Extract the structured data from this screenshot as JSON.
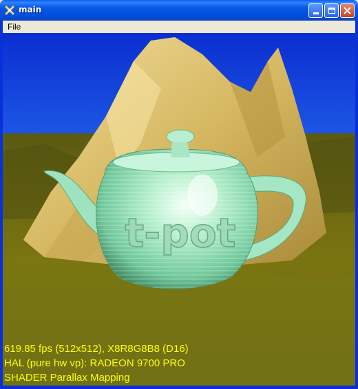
{
  "window": {
    "title": "main"
  },
  "menu": {
    "items": [
      {
        "label": "File"
      }
    ]
  },
  "scene": {
    "teapot_label": "t-pot",
    "sky_color": "#1136d4",
    "ground_color": "#6d6a12",
    "mountain_color": "#d8c070",
    "teapot_color": "#8fe0b8"
  },
  "hud": {
    "line1": "619.85 fps (512x512), X8R8G8B8 (D16)",
    "line2": "HAL (pure hw vp): RADEON 9700 PRO",
    "line3": "SHADER Parallax Mapping"
  }
}
